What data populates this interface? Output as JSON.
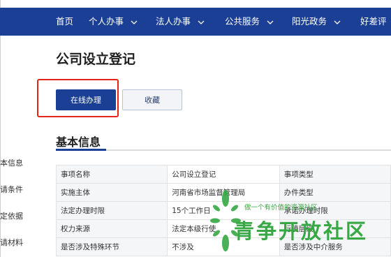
{
  "nav": {
    "items": [
      {
        "label": "首页",
        "has_dropdown": false
      },
      {
        "label": "个人办事",
        "has_dropdown": true
      },
      {
        "label": "法人办事",
        "has_dropdown": true
      },
      {
        "label": "公共服务",
        "has_dropdown": true
      },
      {
        "label": "阳光政务",
        "has_dropdown": true
      },
      {
        "label": "好差评",
        "has_dropdown": false
      }
    ]
  },
  "page": {
    "title": "公司设立登记"
  },
  "actions": {
    "online_label": "在线办理",
    "favorite_label": "收藏"
  },
  "section": {
    "title": "基本信息"
  },
  "side_nav": {
    "fragments": [
      "本信息",
      "请条件",
      "定依据",
      "请材料"
    ]
  },
  "info_table": {
    "rows": [
      [
        "事项名称",
        "公司设立登记",
        "事项类型"
      ],
      [
        "实施主体",
        "河南省市场监督管理局",
        "办件类型"
      ],
      [
        "法定办理时限",
        "15个工作日",
        "承诺办理时限"
      ],
      [
        "权力来源",
        "法定本级行使",
        "行使层级"
      ],
      [
        "是否涉及特殊环节",
        "不涉及",
        "是否涉及中介服务"
      ]
    ]
  },
  "watermark": {
    "tagline": "做一个有价值的资源社区",
    "name": "青争开放社区"
  },
  "colors": {
    "nav_bg": "#1a3f94",
    "primary_button": "#1a3f94",
    "highlight_border": "#e3231c",
    "watermark_green": "#37a844"
  }
}
